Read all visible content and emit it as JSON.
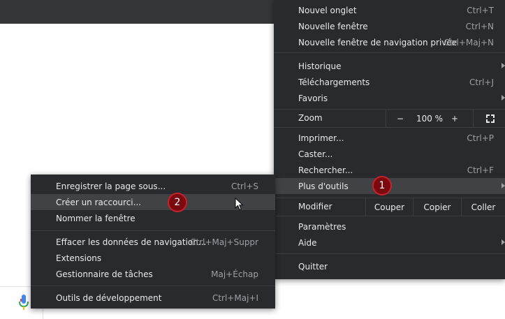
{
  "main_menu": {
    "new_tab": {
      "label": "Nouvel onglet",
      "shortcut": "Ctrl+T"
    },
    "new_window": {
      "label": "Nouvelle fenêtre",
      "shortcut": "Ctrl+N"
    },
    "incognito": {
      "label": "Nouvelle fenêtre de navigation privée",
      "shortcut": "Ctrl+Maj+N"
    },
    "history": {
      "label": "Historique"
    },
    "downloads": {
      "label": "Téléchargements",
      "shortcut": "Ctrl+J"
    },
    "bookmarks": {
      "label": "Favoris"
    },
    "zoom": {
      "label": "Zoom",
      "minus": "−",
      "value": "100 %",
      "plus": "+"
    },
    "print": {
      "label": "Imprimer...",
      "shortcut": "Ctrl+P"
    },
    "cast": {
      "label": "Caster..."
    },
    "find": {
      "label": "Rechercher...",
      "shortcut": "Ctrl+F"
    },
    "more_tools": {
      "label": "Plus d'outils"
    },
    "edit": {
      "label": "Modifier",
      "cut": "Couper",
      "copy": "Copier",
      "paste": "Coller"
    },
    "settings": {
      "label": "Paramètres"
    },
    "help": {
      "label": "Aide"
    },
    "exit": {
      "label": "Quitter"
    }
  },
  "sub_menu": {
    "save_page": {
      "label": "Enregistrer la page sous...",
      "shortcut": "Ctrl+S"
    },
    "create_shortcut": {
      "label": "Créer un raccourci..."
    },
    "name_window": {
      "label": "Nommer la fenêtre"
    },
    "clear_data": {
      "label": "Effacer les données de navigation...",
      "shortcut": "Ctrl+Maj+Suppr"
    },
    "extensions": {
      "label": "Extensions"
    },
    "task_manager": {
      "label": "Gestionnaire de tâches",
      "shortcut": "Maj+Échap"
    },
    "dev_tools": {
      "label": "Outils de développement",
      "shortcut": "Ctrl+Maj+I"
    }
  },
  "annotations": {
    "badge_1": "1",
    "badge_2": "2"
  },
  "colors": {
    "menu_bg": "#292a2d",
    "highlight": "#414245",
    "badge": "#7b0a10",
    "text": "#e8eaed",
    "shortcut_text": "#9aa0a6"
  },
  "icons": {
    "mic": "mic-icon",
    "submenu_arrow": "chevron-right-icon",
    "fullscreen": "fullscreen-icon",
    "cursor": "mouse-pointer-icon"
  }
}
